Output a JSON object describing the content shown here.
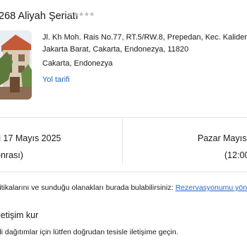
{
  "hotel": {
    "name": "268 Aliyah Şeriatı",
    "stars": "★★★★★",
    "address": "Jl. Kh Moh. Rais No.77, RT.5/RW.8, Prepedan, Kec. Kalideres,",
    "address_line2": "Jakarta Barat, Cakarta, Endonezya, 11820",
    "city": "Cakarta, Endonezya",
    "route_link": "Yol tarifi",
    "photo_colors": {
      "roof": "#c45a38",
      "wall": "#d8cdb8",
      "foliage": "#5d7a3c",
      "sky": "#e9eef2"
    }
  },
  "stay": {
    "checkin_date": "si 17 Mayıs 2025",
    "checkin_time": "onrası)",
    "checkout_date": "Pazar Mayıs",
    "checkout_time": "(12:00"
  },
  "policy": {
    "text": "litikalarını ve sunduğu olanakları burada bulabilirsiniz: ",
    "link": "Rezervasyonumu yön"
  },
  "contact": {
    "title": "letişim kur",
    "text": "ili dağıtımlar için lütfen doğrudan tesisle iletişime geçin."
  }
}
